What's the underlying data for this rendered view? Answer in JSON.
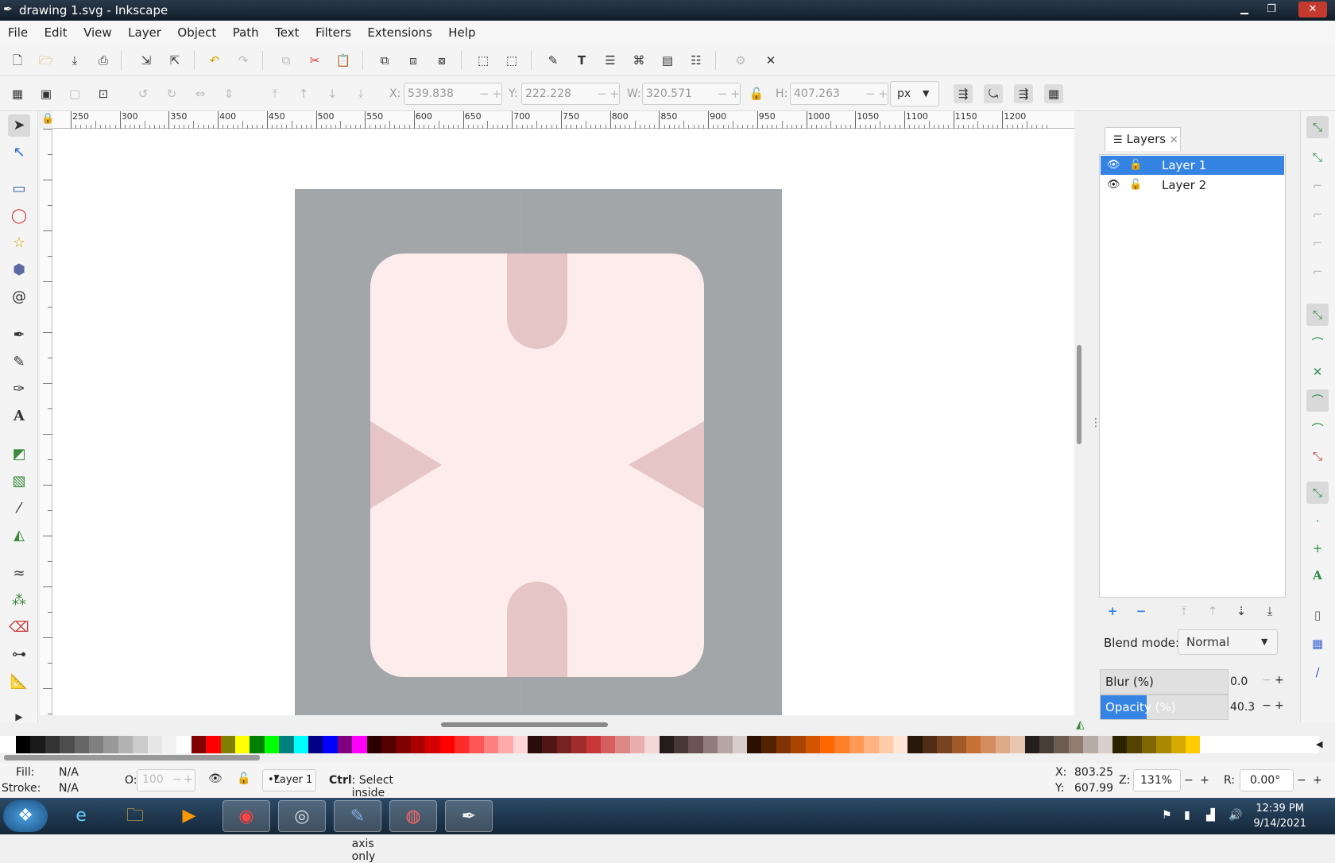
{
  "window": {
    "title": "drawing 1.svg - Inkscape"
  },
  "menu": [
    "File",
    "Edit",
    "View",
    "Layer",
    "Object",
    "Path",
    "Text",
    "Filters",
    "Extensions",
    "Help"
  ],
  "toolcontrols": {
    "x_label": "X:",
    "x_value": "539.838",
    "y_label": "Y:",
    "y_value": "222.228",
    "w_label": "W:",
    "w_value": "320.571",
    "h_label": "H:",
    "h_value": "407.263",
    "unit": "px"
  },
  "ruler_ticks": [
    "250",
    "300",
    "350",
    "400",
    "450",
    "500",
    "550",
    "600",
    "650",
    "700",
    "750",
    "800",
    "850",
    "900",
    "950",
    "1000",
    "1050",
    "1100",
    "1150",
    "1200"
  ],
  "layers": {
    "tab_label": "Layers",
    "items": [
      {
        "name": "Layer 1",
        "selected": true
      },
      {
        "name": "Layer 2",
        "selected": false
      }
    ],
    "blend_label": "Blend mode:",
    "blend_value": "Normal",
    "blur_label": "Blur (%)",
    "blur_value": "0.0",
    "opacity_label": "Opacity (%)",
    "opacity_value": "40.3",
    "opacity_fraction": 0.403
  },
  "status": {
    "fill_label": "Fill:",
    "fill_value": "N/A",
    "stroke_label": "Stroke:",
    "stroke_value": "N/A",
    "o_label": "O:",
    "o_value": "100",
    "layer": "Layer 1",
    "message_key": "Ctrl",
    "message": ": Select inside groups, Move one axis only",
    "cursor_x_label": "X:",
    "cursor_x": "803.25",
    "cursor_y_label": "Y:",
    "cursor_y": "607.99",
    "zoom_label": "Z:",
    "zoom": "131%",
    "rotation_label": "R:",
    "rotation": "0.00°"
  },
  "clock": {
    "time": "12:39 PM",
    "date": "9/14/2021"
  },
  "colors": {
    "accent": "#3584e4",
    "page": "#a3a6a8",
    "card": "#fdecec",
    "shape": "#e6c5c6"
  },
  "palette": [
    "#000000",
    "#1a1a1a",
    "#333333",
    "#4d4d4d",
    "#666666",
    "#808080",
    "#999999",
    "#b3b3b3",
    "#cccccc",
    "#e6e6e6",
    "#f2f2f2",
    "#ffffff",
    "#800000",
    "#ff0000",
    "#808000",
    "#ffff00",
    "#008000",
    "#00ff00",
    "#008080",
    "#00ffff",
    "#000080",
    "#0000ff",
    "#800080",
    "#ff00ff",
    "#2b0000",
    "#550000",
    "#800000",
    "#aa0000",
    "#d40000",
    "#ff0000",
    "#ff2a2a",
    "#ff5555",
    "#ff8080",
    "#ffaaaa",
    "#ffd5d5",
    "#280b0b",
    "#501616",
    "#782121",
    "#a02c2c",
    "#c83737",
    "#d35f5f",
    "#de8787",
    "#e9afaf",
    "#f4d7d7",
    "#241c1c",
    "#483737",
    "#6c5353",
    "#917c7c",
    "#b7a5a5",
    "#d9cccc",
    "#2b1100",
    "#552200",
    "#803300",
    "#aa4400",
    "#d45500",
    "#ff6600",
    "#ff7f2a",
    "#ff9955",
    "#ffb380",
    "#ffccaa",
    "#ffe6d5",
    "#28170b",
    "#502d16",
    "#784421",
    "#a05a2c",
    "#c87137",
    "#d38d5f",
    "#deaa87",
    "#e9c6af",
    "#241f1c",
    "#483e37",
    "#6c5d53",
    "#917c6f",
    "#b7aca5",
    "#d9cfcc",
    "#2b2200",
    "#554400",
    "#806600",
    "#aa8800",
    "#d4aa00",
    "#ffcc00"
  ]
}
